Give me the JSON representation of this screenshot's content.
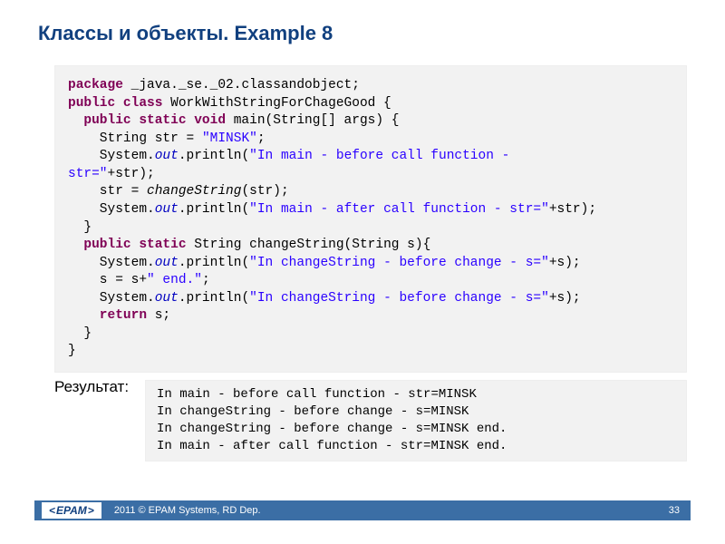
{
  "title": "Классы и объекты. Example 8",
  "code": {
    "l1a": "package",
    "l1b": " _java._se._02.classandobject;",
    "l2a": "public class",
    "l2b": " WorkWithStringForChageGood {",
    "l3a": "  public static void",
    "l3b": " main(String[] args) {",
    "l4a": "    String str = ",
    "l4b": "\"MINSK\"",
    "l4c": ";",
    "l5a": "    System.",
    "l5b": "out",
    "l5c": ".println(",
    "l5d": "\"In main - before call function -\nstr=\"",
    "l5e": "+str);",
    "l6a": "    str = ",
    "l6b": "changeString",
    "l6c": "(str);",
    "l7a": "    System.",
    "l7b": "out",
    "l7c": ".println(",
    "l7d": "\"In main - after call function - str=\"",
    "l7e": "+str);",
    "l8": "  }",
    "l9a": "  public static",
    "l9b": " String changeString(String s){",
    "l10a": "    System.",
    "l10b": "out",
    "l10c": ".println(",
    "l10d": "\"In changeString - before change - s=\"",
    "l10e": "+s);",
    "l11a": "    s = s+",
    "l11b": "\" end.\"",
    "l11c": ";",
    "l12a": "    System.",
    "l12b": "out",
    "l12c": ".println(",
    "l12d": "\"In changeString - before change - s=\"",
    "l12e": "+s);",
    "l13a": "    return",
    "l13b": " s;",
    "l14": "  }",
    "l15": "}"
  },
  "result_label": "Результат:",
  "output": "In main - before call function - str=MINSK\nIn changeString - before change - s=MINSK\nIn changeString - before change - s=MINSK end.\nIn main - after call function - str=MINSK end.",
  "footer": {
    "logo": "EPAM",
    "copyright": "2011 © EPAM Systems, RD Dep.",
    "page": "33"
  }
}
